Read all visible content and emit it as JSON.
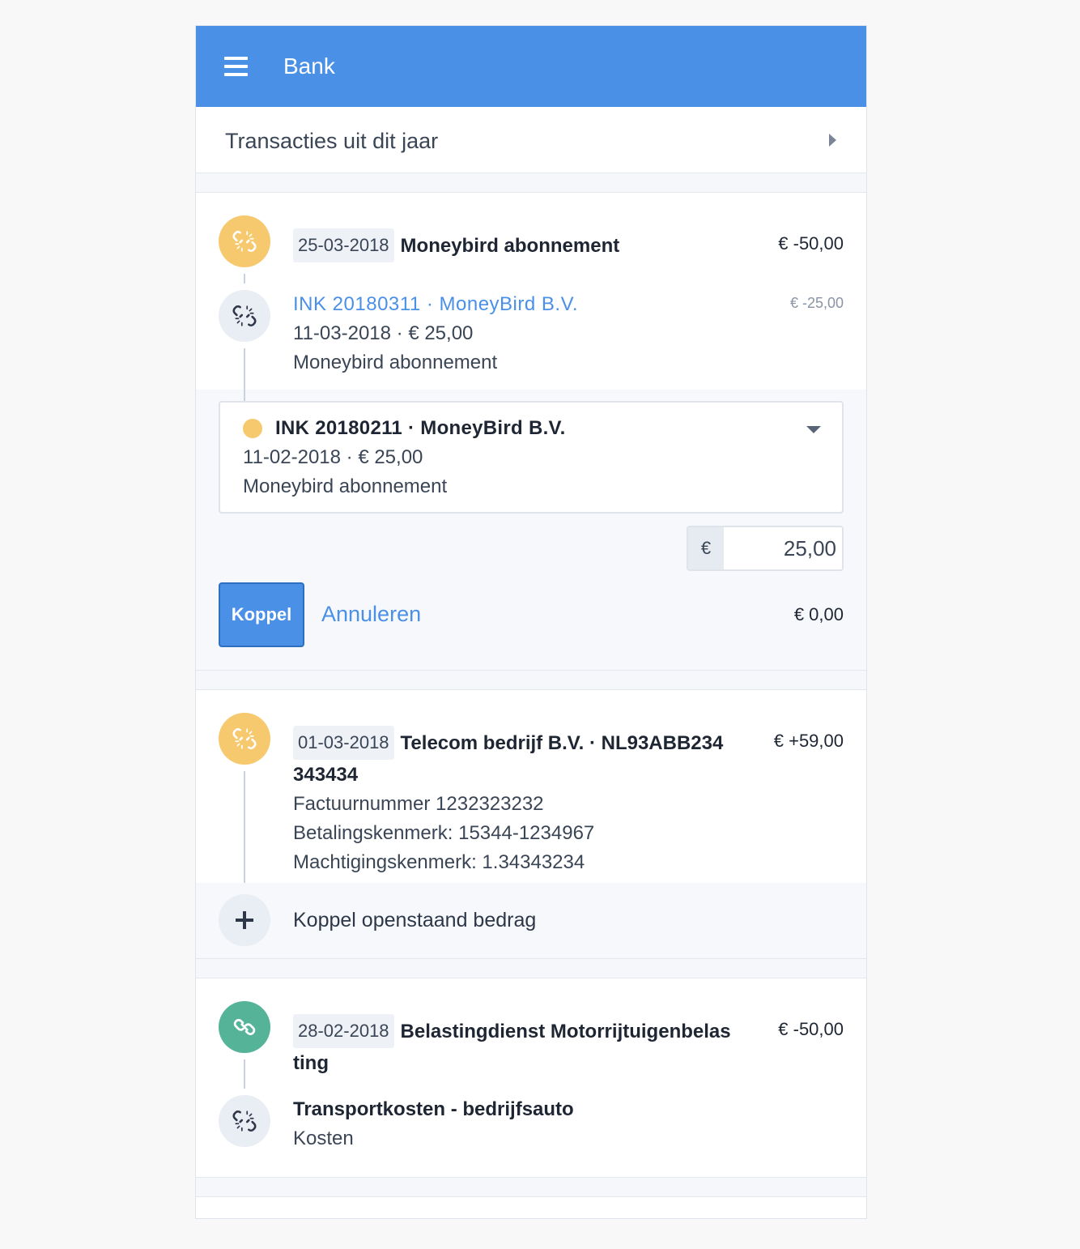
{
  "app": {
    "title": "Bank"
  },
  "period": {
    "label": "Transacties uit dit jaar"
  },
  "transactions": [
    {
      "date": "25-03-2018",
      "title": "Moneybird abonnement",
      "amount": "€ -50,00",
      "status_color": "#f7c96e",
      "linked": {
        "link": "INK 20180311 · MoneyBird B.V.",
        "amount": "€ -25,00",
        "meta": "11-03-2018 · € 25,00",
        "description": "Moneybird abonnement"
      },
      "selector": {
        "title": "INK 20180211 · MoneyBird B.V.",
        "meta": "11-02-2018 · € 25,00",
        "description": "Moneybird abonnement"
      },
      "amount_field": {
        "currency": "€",
        "value": "25,00"
      },
      "actions": {
        "confirm": "Koppel",
        "cancel": "Annuleren",
        "remaining": "€ 0,00"
      }
    },
    {
      "date": "01-03-2018",
      "title_line1": "Telecom bedrijf B.V. · NL93ABB234",
      "title_line2": "343434",
      "amount": "€ +59,00",
      "status_color": "#f7c96e",
      "details": [
        "Factuurnummer 1232323232",
        "Betalingskenmerk: 15344-1234967",
        "Machtigingskenmerk: 1.34343234"
      ],
      "link_action": "Koppel openstaand bedrag"
    },
    {
      "date": "28-02-2018",
      "title_line1": "Belastingdienst Motorrijtuigenbelas",
      "title_line2": "ting",
      "amount": "€ -50,00",
      "status_color": "#55b397",
      "linked": {
        "title": "Transportkosten - bedrijfsauto",
        "subtitle": "Kosten"
      }
    }
  ],
  "colors": {
    "accent": "#4a90e6",
    "pending": "#f7c96e",
    "done": "#55b397"
  },
  "icons": [
    "menu-icon",
    "chevron-right-icon",
    "broken-link-icon",
    "link-icon",
    "chevron-down-icon",
    "plus-icon"
  ]
}
